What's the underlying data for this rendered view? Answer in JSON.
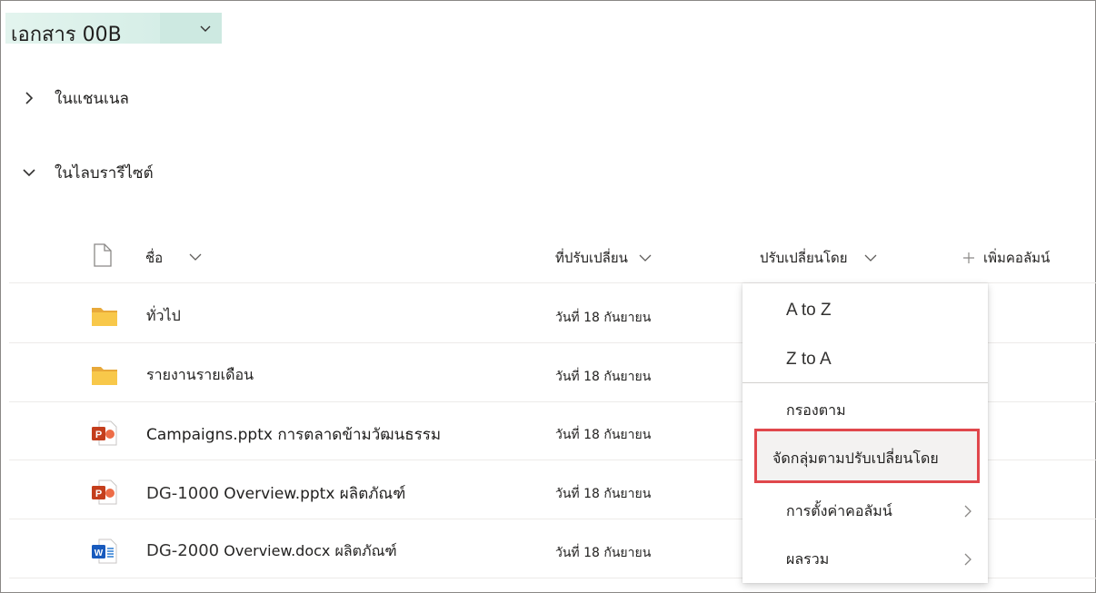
{
  "library": {
    "title": "เอกสาร 00B"
  },
  "sections": [
    {
      "label": "ในแชนเนล",
      "expanded": false
    },
    {
      "label": "ในไลบรารีไซต์",
      "expanded": true
    }
  ],
  "table": {
    "columns": {
      "name": "ชื่อ",
      "modified": "ที่ปรับเปลี่ยน",
      "modified_by": "ปรับเปลี่ยนโดย",
      "add_column": "เพิ่มคอลัมน์"
    },
    "rows": [
      {
        "type": "folder-icon",
        "name_prefix": "",
        "name": "ทั่วไป",
        "modified": "วันที่ 18 กันยายน"
      },
      {
        "type": "folder-icon",
        "name_prefix": "",
        "name": "รายงานรายเดือน",
        "modified": "วันที่ 18 กันยายน"
      },
      {
        "type": "powerpoint-icon",
        "name_prefix": "",
        "name": "Campaigns.pptx การตลาดข้ามวัฒนธรรม",
        "modified": "วันที่ 18 กันยายน"
      },
      {
        "type": "powerpoint-icon",
        "name_prefix": "DG-1000",
        "name": "Overview.pptx ผลิตภัณฑ์",
        "modified": "วันที่ 18 กันยายน"
      },
      {
        "type": "word-icon",
        "name_prefix": "DG-2000",
        "name": "Overview.docx ผลิตภัณฑ์",
        "modified": "วันที่ 18 กันยายน"
      }
    ]
  },
  "column_menu": {
    "sort_az": "A to Z",
    "sort_za": "Z to A",
    "filter_by": "กรองตาม",
    "group_by": "จัดกลุ่มตามปรับเปลี่ยนโดย",
    "column_settings": "การตั้งค่าคอลัมน์",
    "totals": "ผลรวม"
  },
  "colors": {
    "title_highlight": "#cde9e1",
    "callout_border": "#e0474c",
    "folder": "#f8c84a",
    "powerpoint": "#c43e1c",
    "word": "#185abd"
  }
}
